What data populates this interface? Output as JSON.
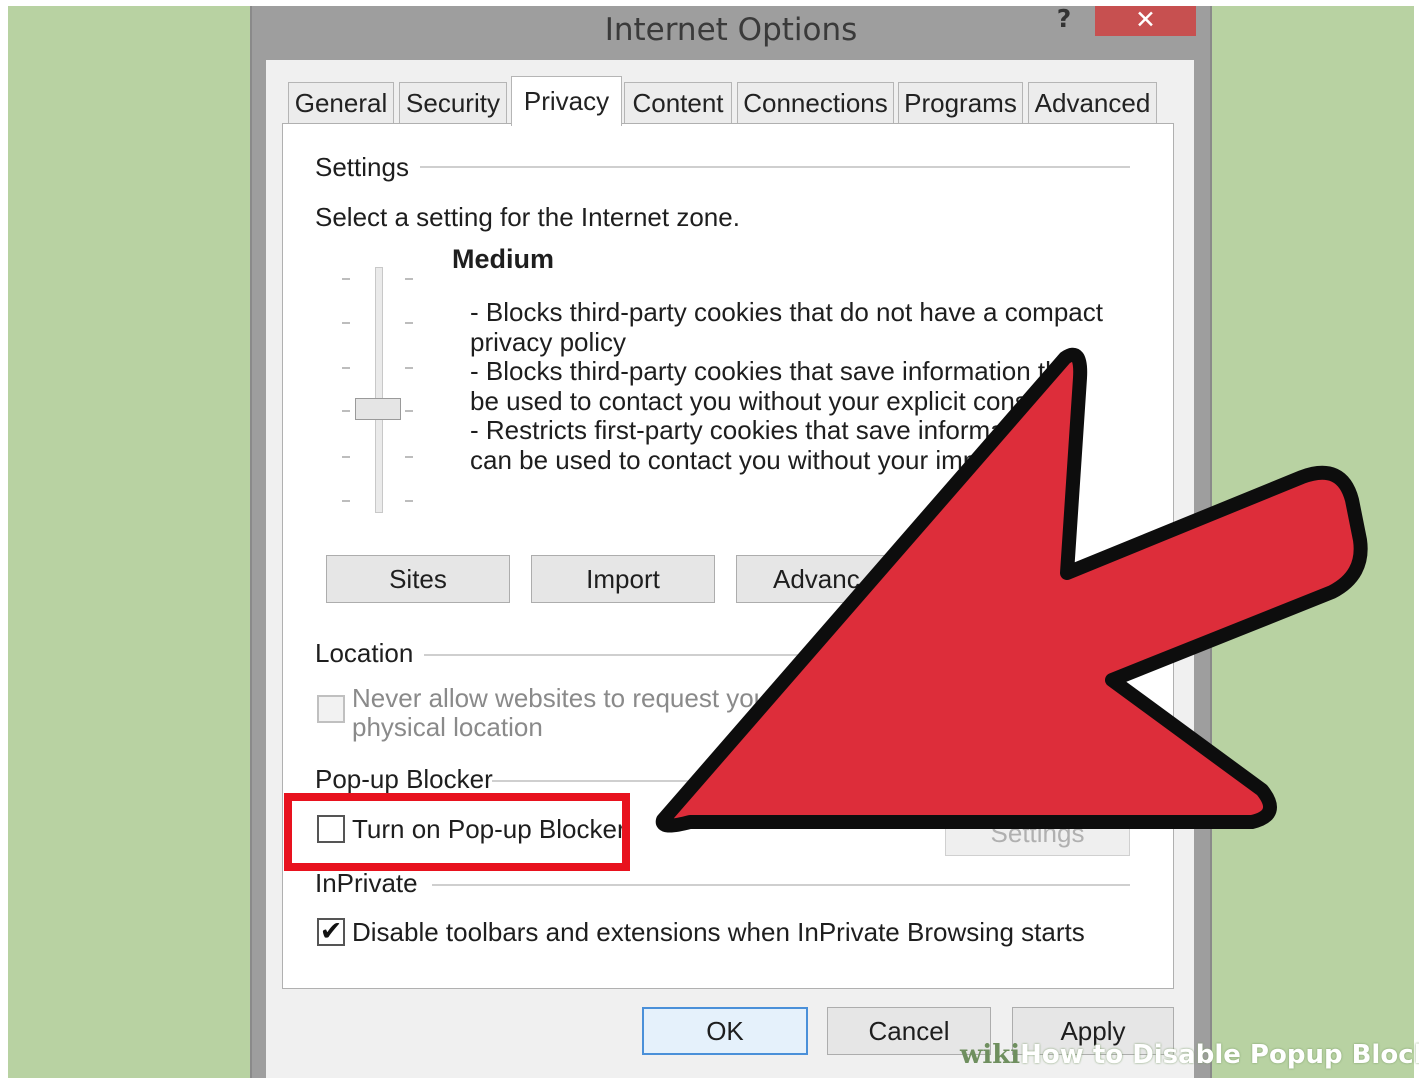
{
  "window": {
    "title": "Internet Options",
    "help_label": "?",
    "close_label": "✕"
  },
  "tabs": [
    {
      "label": "General"
    },
    {
      "label": "Security"
    },
    {
      "label": "Privacy",
      "active": true
    },
    {
      "label": "Content"
    },
    {
      "label": "Connections"
    },
    {
      "label": "Programs"
    },
    {
      "label": "Advanced"
    }
  ],
  "settings": {
    "header": "Settings",
    "instruction": "Select a setting for the Internet zone.",
    "level_title": "Medium",
    "description_lines": [
      "- Blocks third-party cookies that do not have a compact",
      "privacy policy",
      "- Blocks third-party cookies that save information th",
      "be used to contact you without your explicit cons",
      "- Restricts first-party cookies that save informa",
      "can be used to contact you without your impl"
    ],
    "slider_level_fraction": 0.57,
    "buttons": {
      "sites": "Sites",
      "import": "Import",
      "advanced": "Advanc"
    }
  },
  "location": {
    "header": "Location",
    "checkbox_label_line1": "Never allow websites to request you",
    "checkbox_label_line2": "physical location",
    "checked": false
  },
  "popup_blocker": {
    "header": "Pop-up Blocker",
    "checkbox_label": "Turn on Pop-up Blocker",
    "checked": false,
    "settings_button": "Settings"
  },
  "inprivate": {
    "header": "InPrivate",
    "checkbox_label": "Disable toolbars and extensions when InPrivate Browsing starts",
    "checked": true,
    "check_glyph": "✔"
  },
  "footer": {
    "ok": "OK",
    "cancel": "Cancel",
    "apply": "Apply"
  },
  "watermark": {
    "brand": "wiki",
    "text": "How to Disable Popup Blocke"
  },
  "colors": {
    "highlight": "#e8121e",
    "arrow_fill": "#dd2d3a",
    "background": "#b8d2a2"
  }
}
